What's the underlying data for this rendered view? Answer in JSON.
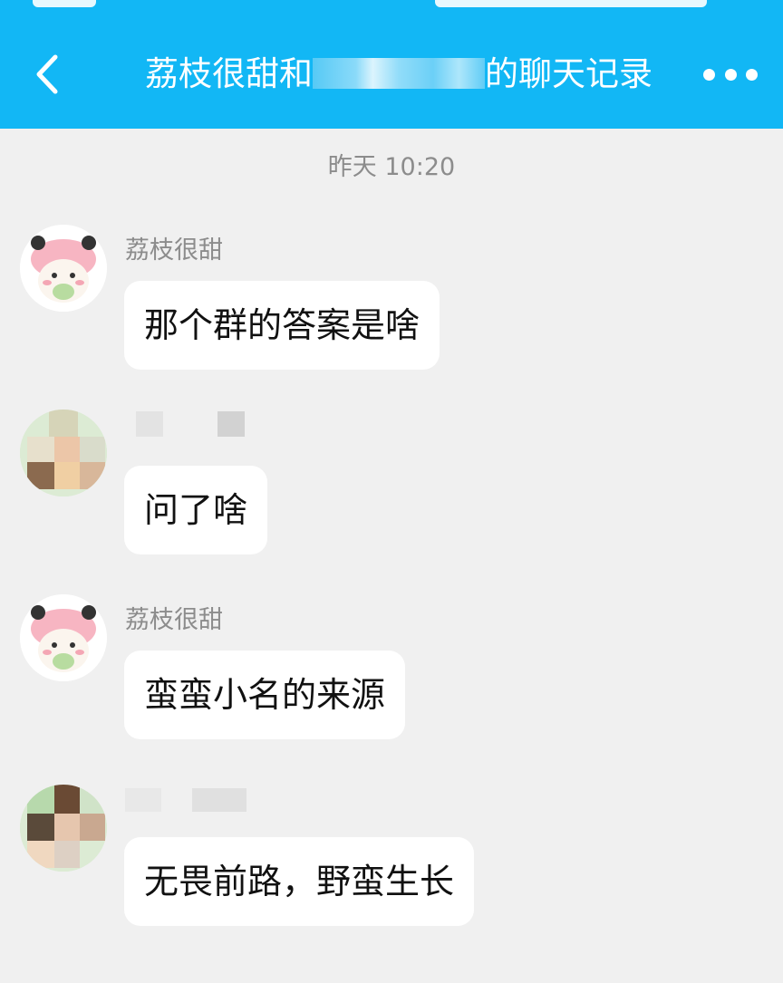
{
  "header": {
    "title_prefix": "荔枝很甜和",
    "title_suffix": "的聊天记录",
    "back_icon": "chevron-left-icon",
    "more_icon": "more-dots-icon",
    "background_color": "#12b7f5"
  },
  "chat": {
    "timestamp": "昨天  10:20",
    "messages": [
      {
        "sender": "荔枝很甜",
        "text": "那个群的答案是啥",
        "avatar": "panda-hat-avatar"
      },
      {
        "sender": "",
        "text": "问了啥",
        "avatar": "blurred-avatar"
      },
      {
        "sender": "荔枝很甜",
        "text": "蛮蛮小名的来源",
        "avatar": "panda-hat-avatar"
      },
      {
        "sender": "",
        "text": "无畏前路，野蛮生长",
        "avatar": "blurred-avatar"
      }
    ]
  }
}
